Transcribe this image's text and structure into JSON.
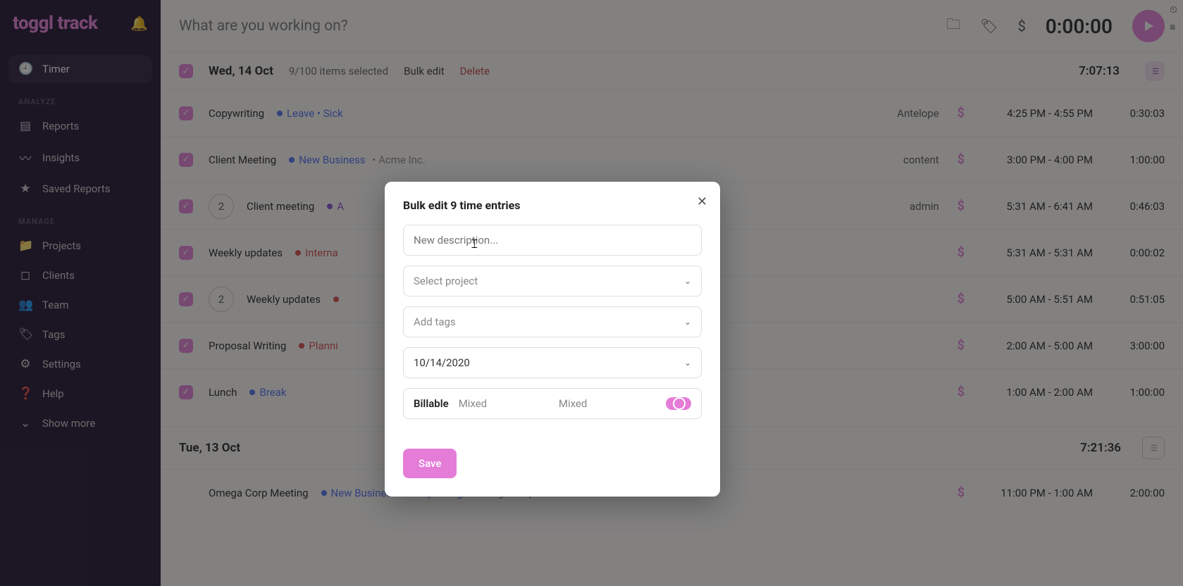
{
  "logo": "toggl track",
  "sidebar": {
    "timer": "Timer",
    "section_analyze": "ANALYZE",
    "reports": "Reports",
    "insights": "Insights",
    "saved_reports": "Saved Reports",
    "section_manage": "MANAGE",
    "projects": "Projects",
    "clients": "Clients",
    "team": "Team",
    "tags": "Tags",
    "settings": "Settings",
    "help": "Help",
    "show_more": "Show more"
  },
  "topbar": {
    "placeholder": "What are you working on?",
    "timer": "0:00:00"
  },
  "day1": {
    "name": "Wed, 14 Oct",
    "selection": "9/100 items selected",
    "bulk_edit": "Bulk edit",
    "delete": "Delete",
    "total": "7:07:13"
  },
  "entries": [
    {
      "desc": "Copywriting",
      "proj": "Leave",
      "sub": "Sick",
      "color": "#4c6ef5",
      "client": "",
      "tag": "Antelope",
      "count": "",
      "range": "4:25 PM - 4:55 PM",
      "dur": "0:30:03"
    },
    {
      "desc": "Client Meeting",
      "proj": "New Business",
      "sub": "",
      "color": "#4c6ef5",
      "client": "Acme Inc.",
      "tag": "content",
      "count": "",
      "range": "3:00 PM - 4:00 PM",
      "dur": "1:00:00"
    },
    {
      "desc": "Client meeting",
      "proj": "A",
      "sub": "",
      "color": "#8a4dd6",
      "client": "",
      "tag": "admin",
      "count": "2",
      "range": "5:31 AM - 6:41 AM",
      "dur": "0:46:03"
    },
    {
      "desc": "Weekly updates",
      "proj": "Interna",
      "sub": "",
      "color": "#d94b4b",
      "client": "",
      "tag": "",
      "count": "",
      "range": "5:31 AM - 5:31 AM",
      "dur": "0:00:02"
    },
    {
      "desc": "Weekly updates",
      "proj": "",
      "sub": "",
      "color": "#d94b4b",
      "client": "",
      "tag": "",
      "count": "2",
      "range": "5:00 AM - 5:51 AM",
      "dur": "0:51:05"
    },
    {
      "desc": "Proposal Writing",
      "proj": "Planni",
      "sub": "",
      "color": "#d94b4b",
      "client": "",
      "tag": "",
      "count": "",
      "range": "2:00 AM - 5:00 AM",
      "dur": "3:00:00"
    },
    {
      "desc": "Lunch",
      "proj": "Break",
      "sub": "",
      "color": "#4c6ef5",
      "client": "",
      "tag": "",
      "count": "",
      "range": "1:00 AM - 2:00 AM",
      "dur": "1:00:00"
    }
  ],
  "day2": {
    "name": "Tue, 13 Oct",
    "total": "7:21:36",
    "entry": {
      "desc": "Omega Corp Meeting",
      "proj": "New Business",
      "sub": "Prospecting",
      "color": "#4c6ef5",
      "client": "Omega Corp.",
      "range": "11:00 PM - 1:00 AM",
      "dur": "2:00:00"
    }
  },
  "modal": {
    "title": "Bulk edit 9 time entries",
    "desc_placeholder": "New description...",
    "project_placeholder": "Select project",
    "tags_placeholder": "Add tags",
    "date": "10/14/2020",
    "billable_label": "Billable",
    "billable_value": "Mixed",
    "billable_state": "Mixed",
    "save": "Save"
  }
}
